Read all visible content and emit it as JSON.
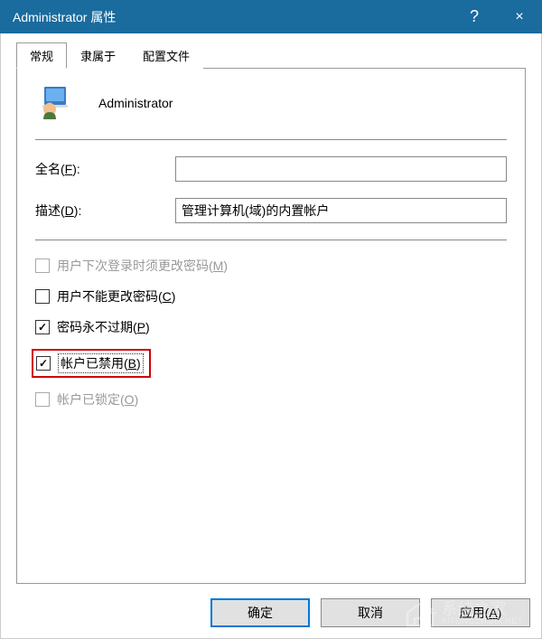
{
  "titlebar": {
    "title": "Administrator 属性",
    "help": "?",
    "close": "×"
  },
  "tabs": {
    "general": "常规",
    "member_of": "隶属于",
    "profile": "配置文件"
  },
  "header": {
    "username": "Administrator"
  },
  "form": {
    "fullname_label": "全名(F):",
    "fullname_value": "",
    "description_label": "描述(D):",
    "description_value": "管理计算机(域)的内置帐户"
  },
  "checkboxes": {
    "must_change_password": "用户下次登录时须更改密码(M)",
    "cannot_change_password": "用户不能更改密码(C)",
    "password_never_expires": "密码永不过期(P)",
    "account_disabled": "帐户已禁用(B)",
    "account_locked": "帐户已锁定(O)"
  },
  "buttons": {
    "ok": "确定",
    "cancel": "取消",
    "apply": "应用(A)"
  },
  "watermark": {
    "brand": "系统之家",
    "url": "XITONGZHIJIA.NET"
  }
}
